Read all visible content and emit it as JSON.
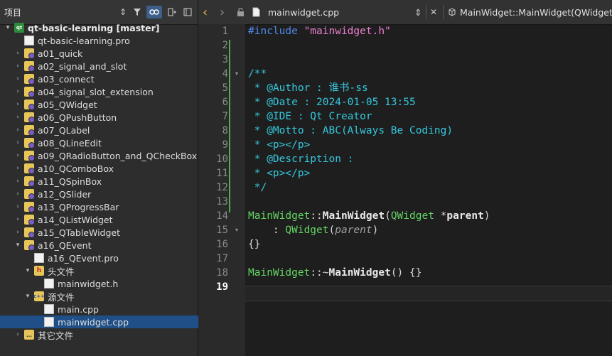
{
  "sidebar": {
    "title": "项目",
    "rows": [
      {
        "label": "qt-basic-learning [master]",
        "level": 0,
        "arrow": "▾",
        "icon": "qt",
        "iconText": "qt",
        "bold": true
      },
      {
        "label": "qt-basic-learning.pro",
        "level": 1,
        "arrow": "",
        "icon": "file"
      },
      {
        "label": "a01_quick",
        "level": 1,
        "arrow": "›",
        "icon": "folder"
      },
      {
        "label": "a02_signal_and_slot",
        "level": 1,
        "arrow": "›",
        "icon": "folder"
      },
      {
        "label": "a03_connect",
        "level": 1,
        "arrow": "›",
        "icon": "folder"
      },
      {
        "label": "a04_signal_slot_extension",
        "level": 1,
        "arrow": "›",
        "icon": "folder"
      },
      {
        "label": "a05_QWidget",
        "level": 1,
        "arrow": "›",
        "icon": "folder"
      },
      {
        "label": "a06_QPushButton",
        "level": 1,
        "arrow": "›",
        "icon": "folder"
      },
      {
        "label": "a07_QLabel",
        "level": 1,
        "arrow": "›",
        "icon": "folder"
      },
      {
        "label": "a08_QLineEdit",
        "level": 1,
        "arrow": "›",
        "icon": "folder"
      },
      {
        "label": "a09_QRadioButton_and_QCheckBox",
        "level": 1,
        "arrow": "›",
        "icon": "folder"
      },
      {
        "label": "a10_QComboBox",
        "level": 1,
        "arrow": "›",
        "icon": "folder"
      },
      {
        "label": "a11_QSpinBox",
        "level": 1,
        "arrow": "›",
        "icon": "folder"
      },
      {
        "label": "a12_QSlider",
        "level": 1,
        "arrow": "›",
        "icon": "folder"
      },
      {
        "label": "a13_QProgressBar",
        "level": 1,
        "arrow": "›",
        "icon": "folder"
      },
      {
        "label": "a14_QListWidget",
        "level": 1,
        "arrow": "›",
        "icon": "folder"
      },
      {
        "label": "a15_QTableWidget",
        "level": 1,
        "arrow": "›",
        "icon": "folder"
      },
      {
        "label": "a16_QEvent",
        "level": 1,
        "arrow": "▾",
        "icon": "folder"
      },
      {
        "label": "a16_QEvent.pro",
        "level": 2,
        "arrow": "",
        "icon": "file"
      },
      {
        "label": "头文件",
        "level": 2,
        "arrow": "▾",
        "icon": "hfolder",
        "iconText": "h"
      },
      {
        "label": "mainwidget.h",
        "level": 3,
        "arrow": "",
        "icon": "file"
      },
      {
        "label": "源文件",
        "level": 2,
        "arrow": "▾",
        "icon": "cfolder",
        "iconText": "c++"
      },
      {
        "label": "main.cpp",
        "level": 3,
        "arrow": "",
        "icon": "file"
      },
      {
        "label": "mainwidget.cpp",
        "level": 3,
        "arrow": "",
        "icon": "file",
        "selected": true
      },
      {
        "label": "其它文件",
        "level": 1,
        "arrow": "›",
        "icon": "ofolder",
        "iconText": "…"
      }
    ]
  },
  "topbar": {
    "back": "‹",
    "forward": "›",
    "lock": "🔒",
    "file_name": "mainwidget.cpp",
    "file_dropdown": "⇕",
    "close": "✕",
    "symbol": "MainWidget::MainWidget(QWidget *"
  },
  "editor": {
    "current_line": 19,
    "lines": [
      [
        [
          "#include ",
          "pp"
        ],
        [
          "\"mainwidget.h\"",
          "str"
        ]
      ],
      [],
      [],
      [
        [
          "/**",
          "cm"
        ]
      ],
      [
        [
          " * @Author : 谁书-ss",
          "cm"
        ]
      ],
      [
        [
          " * @Date : 2024-01-05 13:55",
          "cm"
        ]
      ],
      [
        [
          " * @IDE : Qt Creator",
          "cm"
        ]
      ],
      [
        [
          " * @Motto : ABC(Always Be Coding)",
          "cm"
        ]
      ],
      [
        [
          " * <p></p>",
          "cm"
        ]
      ],
      [
        [
          " * @Description :",
          "cm"
        ]
      ],
      [
        [
          " * <p></p>",
          "cm"
        ]
      ],
      [
        [
          " */",
          "cm"
        ]
      ],
      [],
      [
        [
          "MainWidget",
          "ty"
        ],
        [
          "::",
          "op"
        ],
        [
          "MainWidget",
          "fn"
        ],
        [
          "(",
          "punc"
        ],
        [
          "QWidget",
          "ty"
        ],
        [
          " *",
          "op"
        ],
        [
          "parent",
          "var"
        ],
        [
          ")",
          "punc"
        ]
      ],
      [
        [
          "    : ",
          "op"
        ],
        [
          "QWidget",
          "ty"
        ],
        [
          "(",
          "punc"
        ],
        [
          "parent",
          "par"
        ],
        [
          ")",
          "punc"
        ]
      ],
      [
        [
          "{}",
          "punc"
        ]
      ],
      [],
      [
        [
          "MainWidget",
          "ty"
        ],
        [
          "::~",
          "op"
        ],
        [
          "MainWidget",
          "fn"
        ],
        [
          "() {}",
          "punc"
        ]
      ],
      []
    ],
    "fold_lines": [
      4,
      15
    ]
  }
}
